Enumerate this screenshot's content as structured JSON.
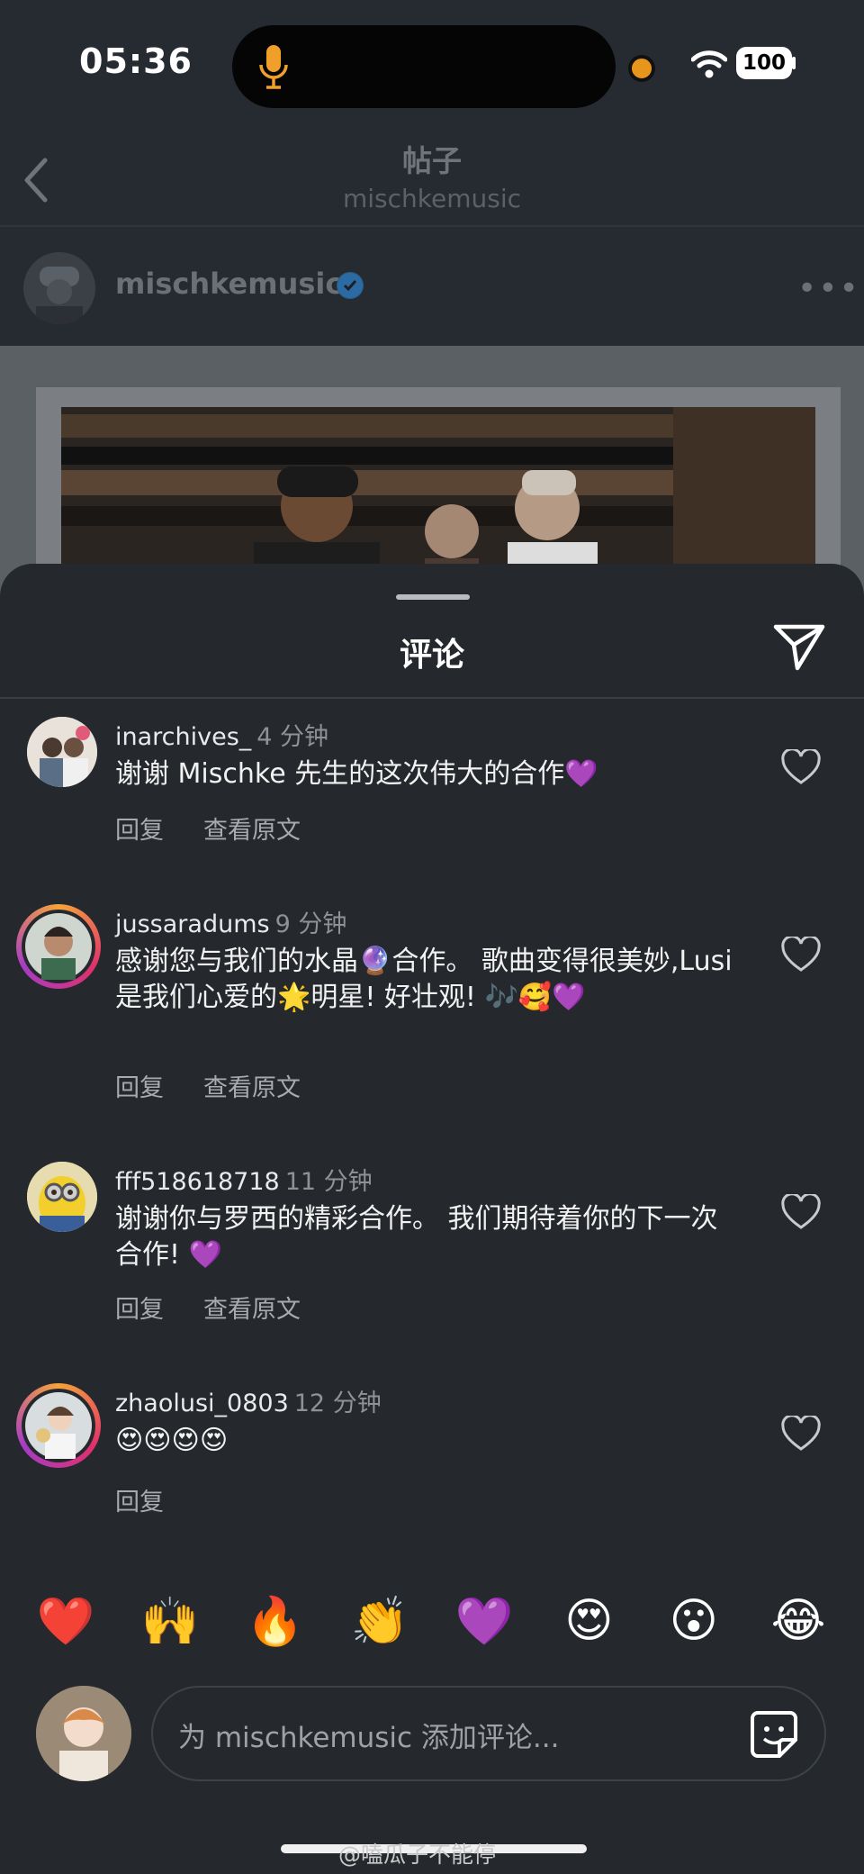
{
  "status_bar": {
    "time": "05:36",
    "battery": "100"
  },
  "nav": {
    "title": "帖子",
    "subtitle": "mischkemusic"
  },
  "post": {
    "username": "mischkemusic",
    "more": "•••"
  },
  "sheet": {
    "title": "评论"
  },
  "comments": [
    {
      "username": "inarchives_",
      "time": "4 分钟",
      "text": "谢谢 Mischke 先生的这次伟大的合作💜",
      "reply": "回复",
      "see_original": "查看原文"
    },
    {
      "username": "jussaradums",
      "time": "9 分钟",
      "text": "感谢您与我们的水晶🔮合作。 歌曲变得很美妙,Lusi 是我们心爱的🌟明星! 好壮观! 🎶🥰💜",
      "reply": "回复",
      "see_original": "查看原文"
    },
    {
      "username": "fff518618718",
      "time": "11 分钟",
      "text": "谢谢你与罗西的精彩合作。 我们期待着你的下一次合作! 💜",
      "reply": "回复",
      "see_original": "查看原文"
    },
    {
      "username": "zhaolusi_0803",
      "time": "12 分钟",
      "text": "😍😍😍😍",
      "reply": "回复"
    }
  ],
  "reactions": [
    "❤️",
    "🙌",
    "🔥",
    "👏",
    "💜",
    "😍",
    "😮",
    "😂"
  ],
  "comment_input": {
    "placeholder": "为 mischkemusic 添加评论..."
  },
  "watermark": "@嗑瓜子不能停",
  "icons": {
    "heart": "heart-icon",
    "share": "paper-plane-icon",
    "back": "chevron-left-icon",
    "sticker": "sticker-icon",
    "mic": "microphone-icon",
    "wifi": "wifi-icon",
    "verified": "verified-badge-icon"
  }
}
